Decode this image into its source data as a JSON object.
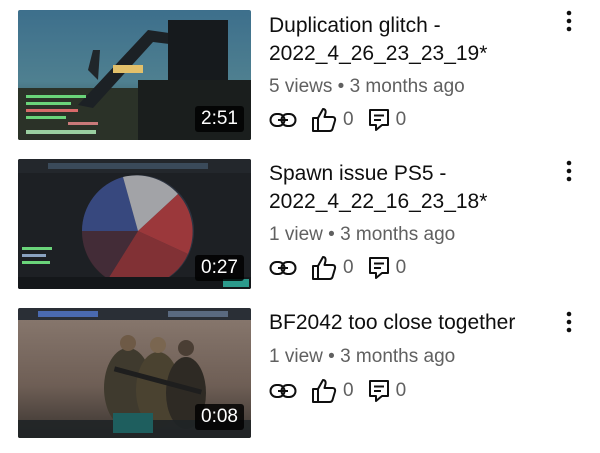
{
  "videos": [
    {
      "title": "Duplication glitch - 2022_4_26_23_23_19*",
      "duration": "2:51",
      "views": "5 views",
      "age": "3 months ago",
      "likes": "0",
      "comments": "0"
    },
    {
      "title": "Spawn issue PS5 - 2022_4_22_16_23_18*",
      "duration": "0:27",
      "views": "1 view",
      "age": "3 months ago",
      "likes": "0",
      "comments": "0"
    },
    {
      "title": "BF2042 too close together",
      "duration": "0:08",
      "views": "1 view",
      "age": "3 months ago",
      "likes": "0",
      "comments": "0"
    }
  ],
  "separator": "•",
  "icons": {
    "share": "link-icon",
    "like": "thumbs-up-icon",
    "comment": "comment-icon",
    "more": "more-vert-icon"
  },
  "colors": {
    "title": "#0f0f0f",
    "meta": "#606060",
    "duration_bg": "#000000"
  }
}
